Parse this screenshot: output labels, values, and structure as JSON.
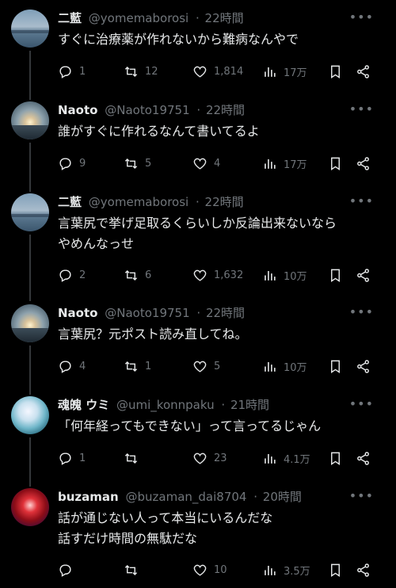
{
  "tweets": [
    {
      "name": "二藍",
      "handle": "@yomemaborosi",
      "time": "22時間",
      "text": "すぐに治療薬が作れないから難病なんやで",
      "replies": "1",
      "retweets": "12",
      "likes": "1,814",
      "views": "17万",
      "avatar": "sea-avatar"
    },
    {
      "name": "Naoto",
      "handle": "@Naoto19751",
      "time": "22時間",
      "text": "誰がすぐに作れるなんて書いてるよ",
      "replies": "9",
      "retweets": "5",
      "likes": "4",
      "views": "17万",
      "avatar": "sunset-avatar"
    },
    {
      "name": "二藍",
      "handle": "@yomemaborosi",
      "time": "22時間",
      "text": "言葉尻で挙げ足取るくらいしか反論出来ないなら\nやめんなっせ",
      "replies": "2",
      "retweets": "6",
      "likes": "1,632",
      "views": "10万",
      "avatar": "sea-avatar"
    },
    {
      "name": "Naoto",
      "handle": "@Naoto19751",
      "time": "22時間",
      "text": "言葉尻？元ポスト読み直してね。",
      "replies": "4",
      "retweets": "1",
      "likes": "5",
      "views": "10万",
      "avatar": "sunset-avatar"
    },
    {
      "name": "魂魄 ウミ",
      "handle": "@umi_konnpaku",
      "time": "21時間",
      "text": "「何年経ってもできない」って言ってるじゃん",
      "replies": "1",
      "retweets": "",
      "likes": "23",
      "views": "4.1万",
      "avatar": "anime-avatar"
    },
    {
      "name": "buzaman",
      "handle": "@buzaman_dai8704",
      "time": "20時間",
      "text": "話が通じない人って本当にいるんだな\n話すだけ時間の無駄だな",
      "replies": "",
      "retweets": "",
      "likes": "10",
      "views": "3.5万",
      "avatar": "robot-avatar"
    }
  ],
  "separator": "·",
  "more_glyph": "•••",
  "colors": {
    "background": "#000000",
    "text": "#e7e9ea",
    "muted": "#71767b",
    "thread_line": "#333639"
  }
}
